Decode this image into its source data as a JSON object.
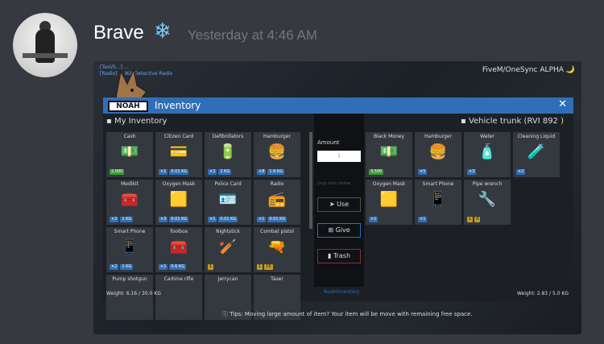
{
  "message": {
    "username": "Brave",
    "emoji": "❄",
    "timestamp": "Yesterday at 4:46 AM"
  },
  "game": {
    "chat_lines": [
      "[Taxi/S...] ...",
      "[Radio] ... IKA Detective Radio"
    ],
    "fivem_label": "FiveM/OneSync ALPHA 🌙",
    "logo_text": "NOAH",
    "window_title": "Inventory",
    "close_label": "✕",
    "my_inventory_label": "My Inventory",
    "vehicle_trunk_label": "Vehicle trunk (RVI 892 )",
    "amount_label": "Amount",
    "amount_placeholder": "1",
    "drop_hint": "Drop item below",
    "use_label": "Use",
    "give_label": "Give",
    "trash_label": "Trash",
    "weight_left": "Weight: 6.16 / 30.0 KG",
    "weight_right": "Weight: 2.83 / 5.0 KG",
    "brand_text": "NoahInventory",
    "tips": "Tips: Moving large amount of item? Your item will be move with remaining free space."
  },
  "left_items": [
    {
      "name": "Cash",
      "icon": "💵",
      "badges": [
        {
          "t": "2,000",
          "c": "green"
        }
      ]
    },
    {
      "name": "Citizen Card",
      "icon": "💳",
      "badges": [
        {
          "t": "×1",
          "c": "blue"
        },
        {
          "t": "0.01 KG",
          "c": "blue"
        }
      ]
    },
    {
      "name": "Defibrillators",
      "icon": "🔋",
      "badges": [
        {
          "t": "×2",
          "c": "blue"
        },
        {
          "t": "2 KG",
          "c": "blue"
        }
      ]
    },
    {
      "name": "Hamburger",
      "icon": "🍔",
      "badges": [
        {
          "t": "×8",
          "c": "blue"
        },
        {
          "t": "1.8 KG",
          "c": "blue"
        }
      ]
    },
    {
      "name": "Medikit",
      "icon": "🧰",
      "badges": [
        {
          "t": "×2",
          "c": "blue"
        },
        {
          "t": "1 KG",
          "c": "blue"
        }
      ]
    },
    {
      "name": "Oxygen Mask",
      "icon": "🟨",
      "badges": [
        {
          "t": "×3",
          "c": "blue"
        },
        {
          "t": "0.01 KG",
          "c": "blue"
        }
      ]
    },
    {
      "name": "Police Card",
      "icon": "🪪",
      "badges": [
        {
          "t": "×1",
          "c": "blue"
        },
        {
          "t": "0.01 KG",
          "c": "blue"
        }
      ]
    },
    {
      "name": "Radio",
      "icon": "📻",
      "badges": [
        {
          "t": "×1",
          "c": "blue"
        },
        {
          "t": "0.01 KG",
          "c": "blue"
        }
      ]
    },
    {
      "name": "Smart Phone",
      "icon": "📱",
      "badges": [
        {
          "t": "×2",
          "c": "blue"
        },
        {
          "t": "1 KG",
          "c": "blue"
        }
      ]
    },
    {
      "name": "Toolbox",
      "icon": "🧰",
      "badges": [
        {
          "t": "×1",
          "c": "blue"
        },
        {
          "t": "0.6 KG",
          "c": "blue"
        }
      ]
    },
    {
      "name": "Nightstick",
      "icon": "🏏",
      "badges": [
        {
          "t": "1",
          "c": "gold"
        }
      ]
    },
    {
      "name": "Combat pistol",
      "icon": "🔫",
      "badges": [
        {
          "t": "1",
          "c": "gold"
        },
        {
          "t": "15",
          "c": "gold"
        }
      ]
    },
    {
      "name": "Pump shotgun",
      "icon": "",
      "badges": []
    },
    {
      "name": "Carbine rifle",
      "icon": "",
      "badges": []
    },
    {
      "name": "Jerrycan",
      "icon": "",
      "badges": []
    },
    {
      "name": "Taser",
      "icon": "",
      "badges": []
    }
  ],
  "right_items": [
    {
      "name": "Black Money",
      "icon": "💵",
      "badges": [
        {
          "t": "3,500",
          "c": "green"
        }
      ]
    },
    {
      "name": "Hamburger",
      "icon": "🍔",
      "badges": [
        {
          "t": "×5",
          "c": "blue"
        }
      ]
    },
    {
      "name": "Water",
      "icon": "🧴",
      "badges": [
        {
          "t": "×3",
          "c": "blue"
        }
      ]
    },
    {
      "name": "Cleaning Liquid",
      "icon": "🧪",
      "badges": [
        {
          "t": "×2",
          "c": "blue"
        }
      ]
    },
    {
      "name": "Oxygen Mask",
      "icon": "🟨",
      "badges": [
        {
          "t": "×1",
          "c": "blue"
        }
      ]
    },
    {
      "name": "Smart Phone",
      "icon": "📱",
      "badges": [
        {
          "t": "×1",
          "c": "blue"
        }
      ]
    },
    {
      "name": "Pipe wrench",
      "icon": "🔧",
      "badges": [
        {
          "t": "1",
          "c": "gold"
        },
        {
          "t": "0",
          "c": "gold"
        }
      ]
    }
  ]
}
